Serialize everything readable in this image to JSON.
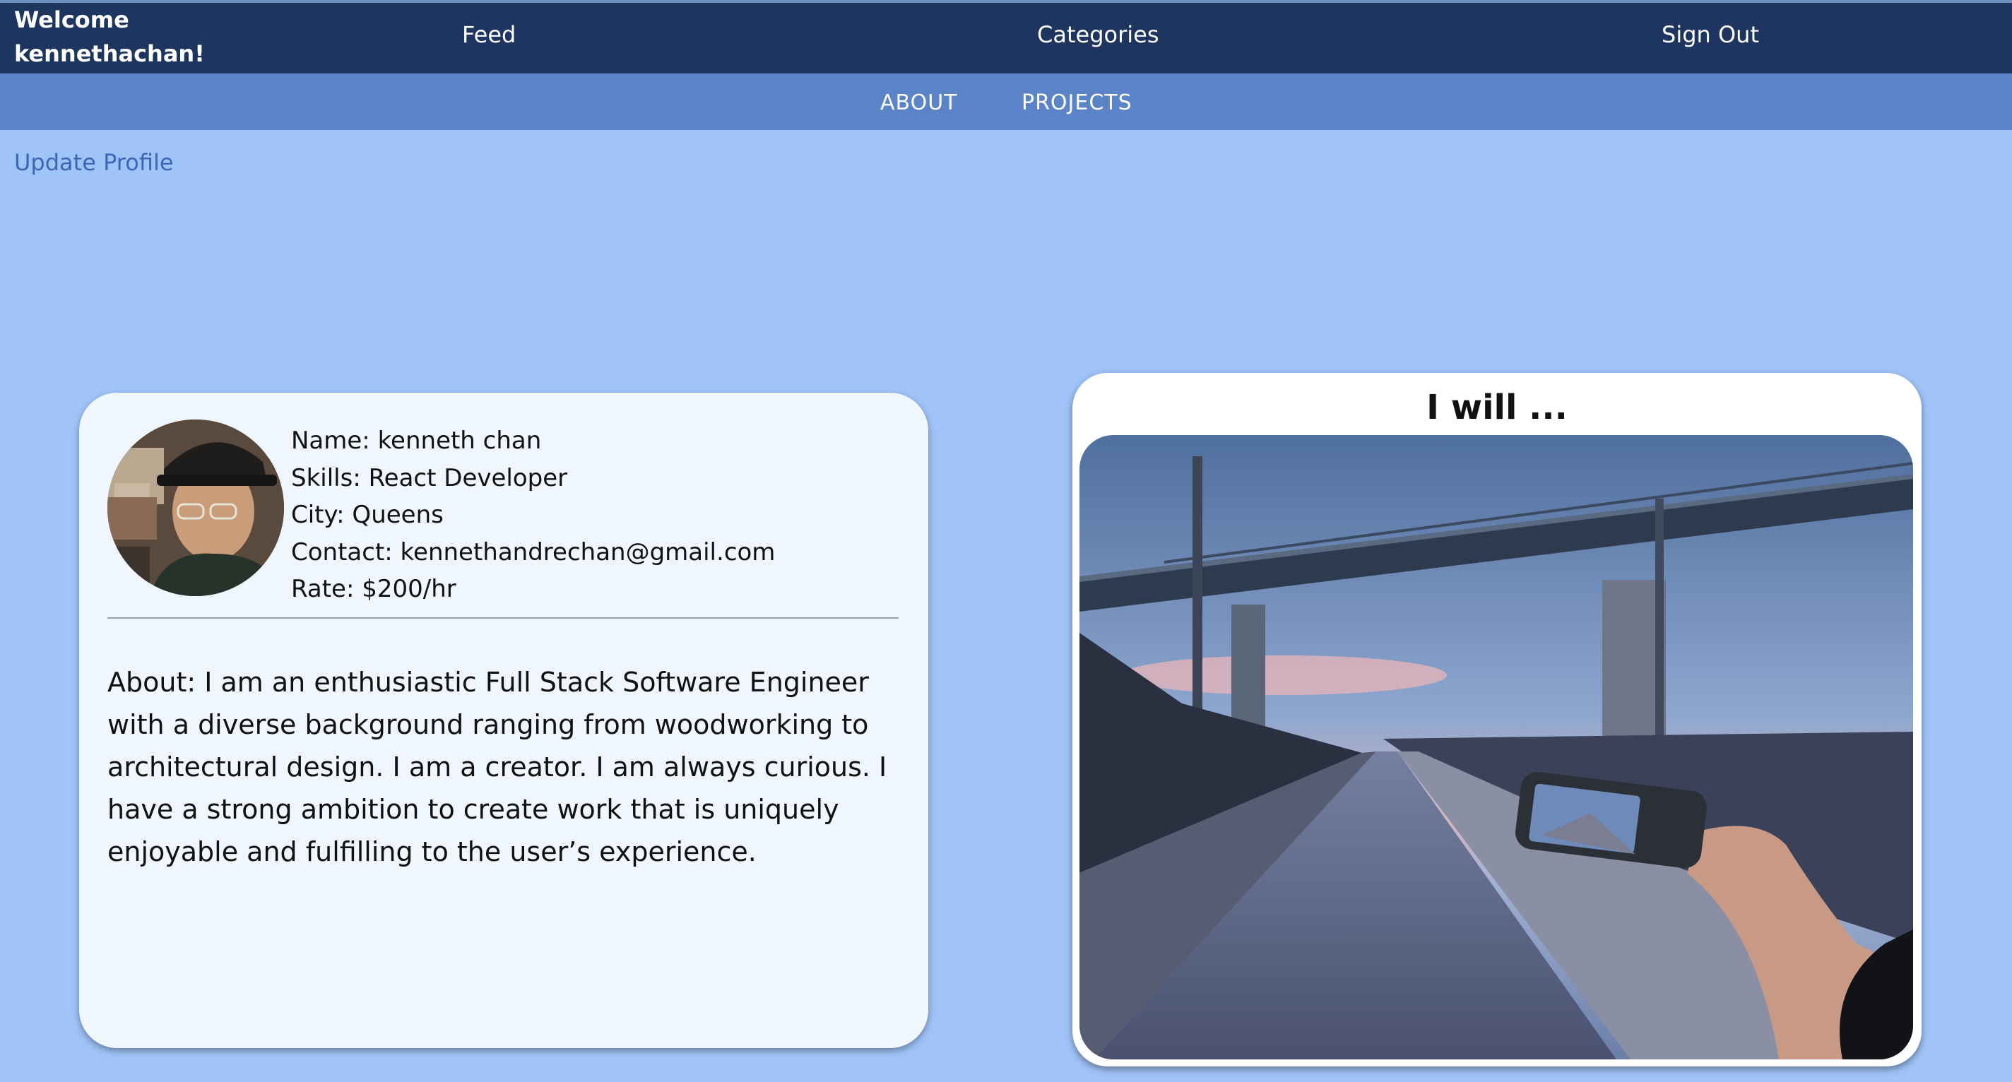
{
  "header": {
    "welcome_line1": "Welcome",
    "welcome_line2": "kennethachan!",
    "nav": {
      "feed": "Feed",
      "categories": "Categories",
      "sign_out": "Sign Out"
    }
  },
  "subnav": {
    "about": "ABOUT",
    "projects": "PROJECTS"
  },
  "update_profile": "Update Profile",
  "profile": {
    "name": "Name: kenneth chan",
    "skills": "Skills: React Developer",
    "city": "City: Queens",
    "contact": "Contact: kennethandrechan@gmail.com",
    "rate": "Rate: $200/hr",
    "about": "About: I am an enthusiastic Full Stack Software Engineer with a diverse background ranging from woodworking to architectural design. I am a creator. I am always curious. I have a strong ambition to create work that is uniquely enjoyable and fulfilling to the user’s experience."
  },
  "promo": {
    "title": "I will ..."
  },
  "colors": {
    "page_bg": "#a0c4f8",
    "topbar_bg": "#1d355f",
    "subnav_bg": "#5b83c8",
    "link": "#3e66b4",
    "card_bg": "#f0f6fd"
  }
}
